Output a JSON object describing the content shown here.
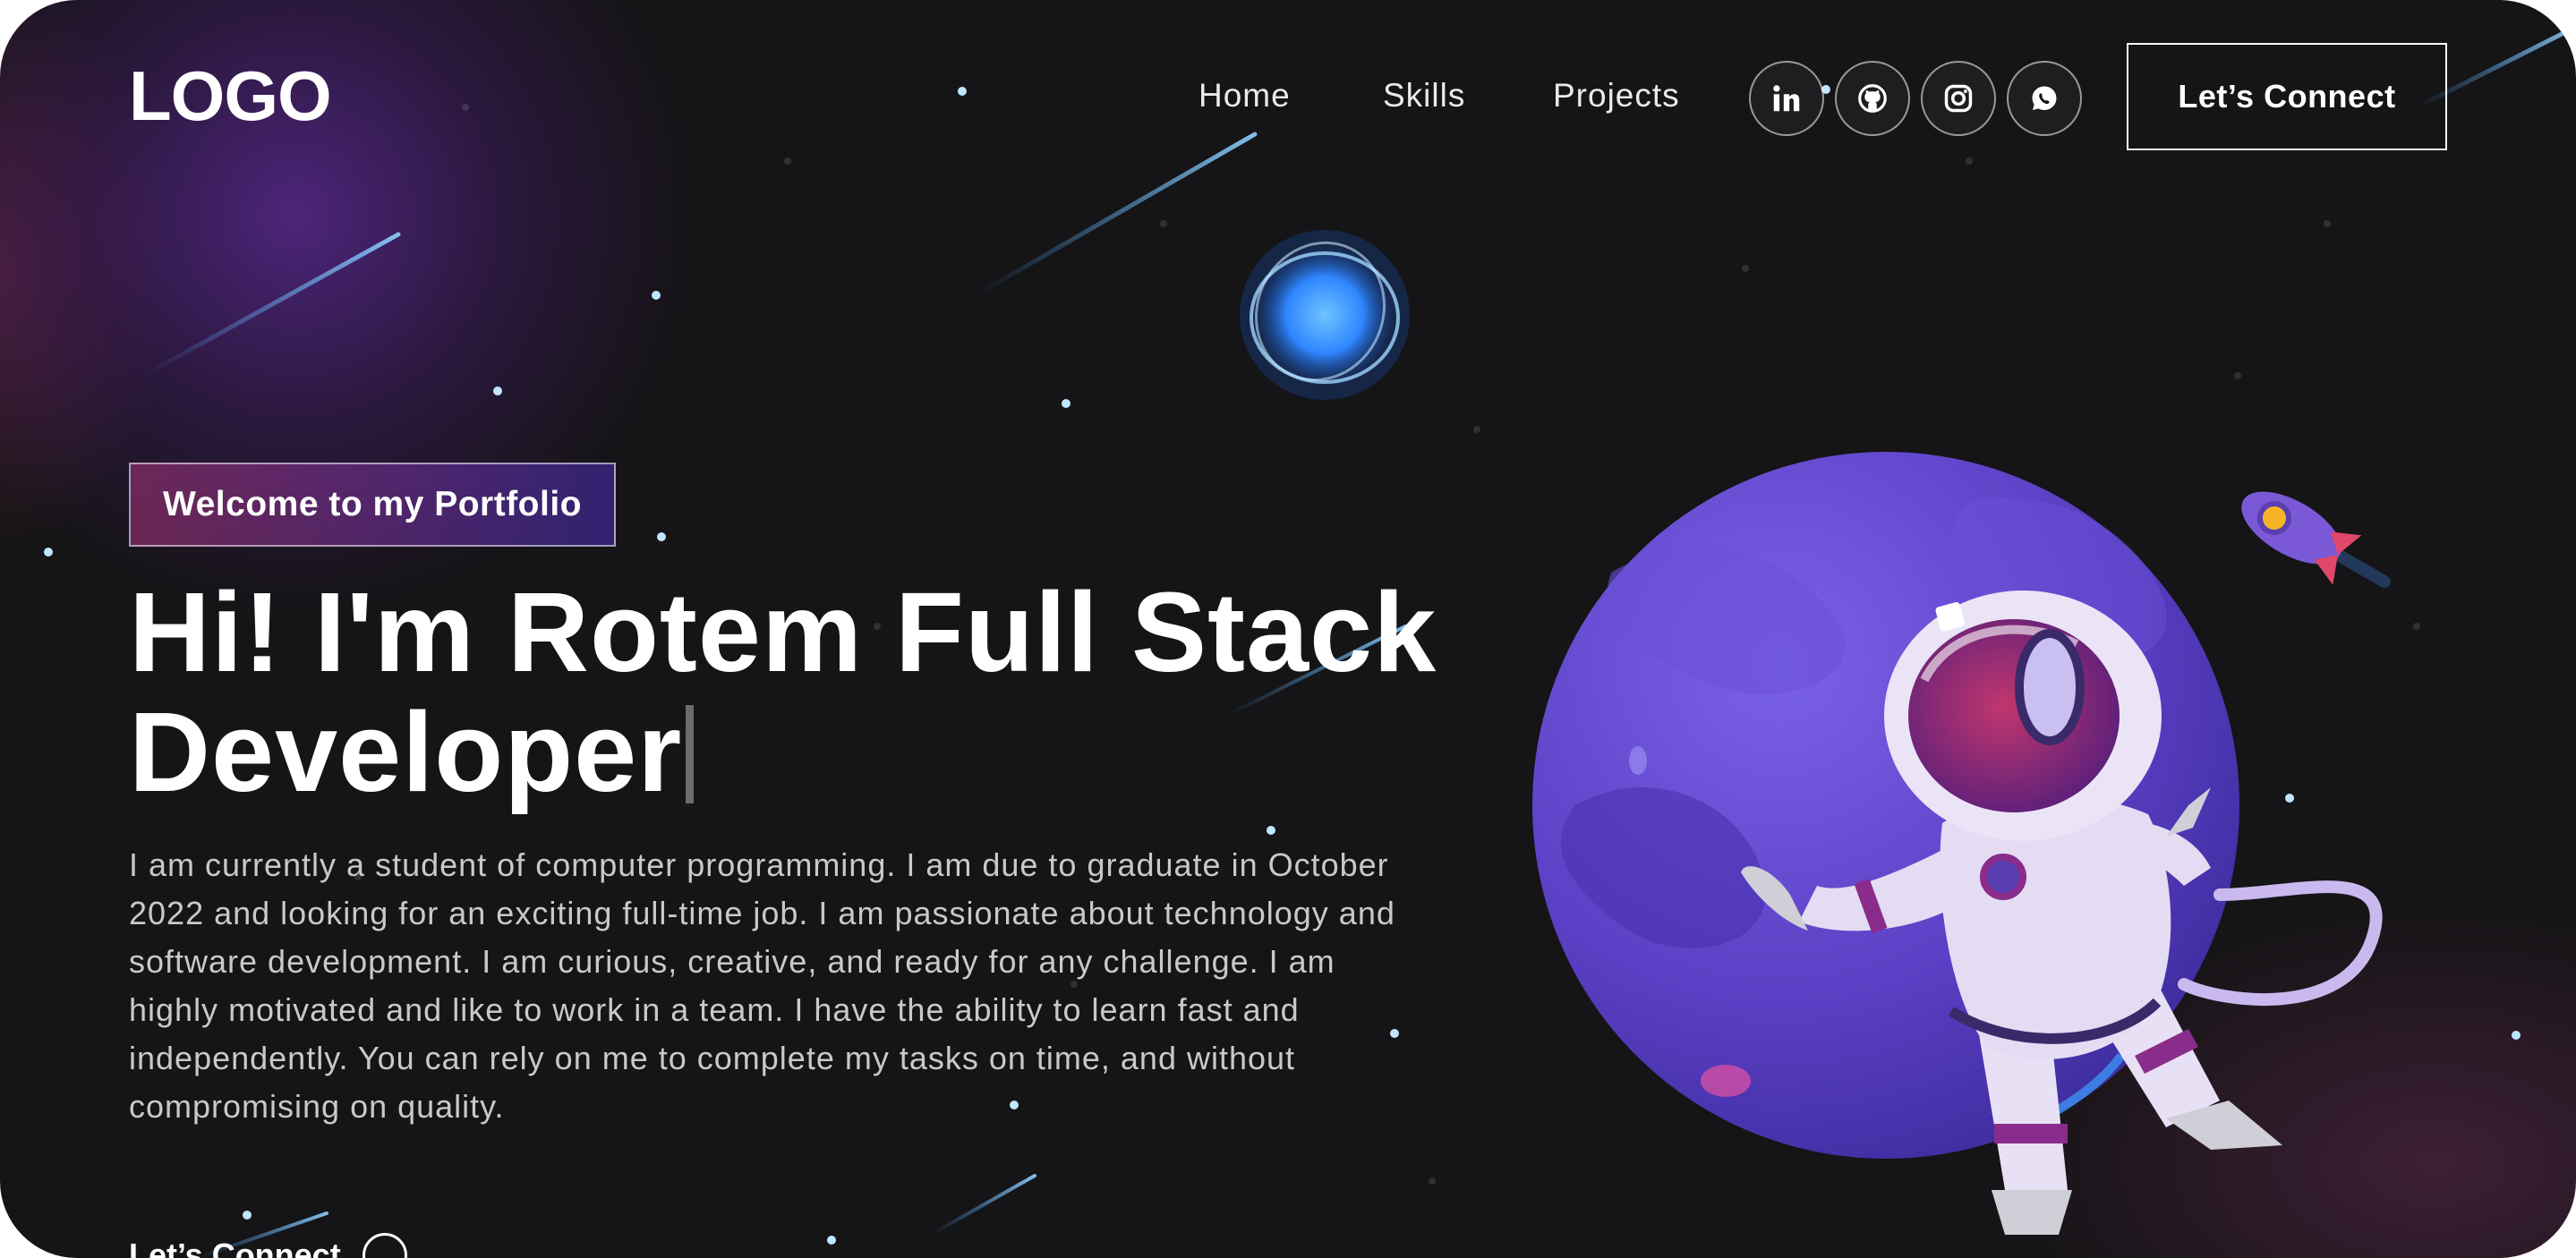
{
  "header": {
    "logo": "LOGO",
    "nav": [
      {
        "label": "Home"
      },
      {
        "label": "Skills"
      },
      {
        "label": "Projects"
      }
    ],
    "social": [
      {
        "icon": "linkedin-icon"
      },
      {
        "icon": "github-icon"
      },
      {
        "icon": "instagram-icon"
      },
      {
        "icon": "whatsapp-icon"
      }
    ],
    "connect_label": "Let’s Connect"
  },
  "banner": {
    "tagline": "Welcome to my Portfolio",
    "headline": "Hi! I'm Rotem Full Stack Developer",
    "intro": "I am currently a student of computer programming. I am due to graduate in October 2022 and looking for an exciting full-time job. I am passionate about technology and software development. I am curious, creative, and ready for any challenge. I am highly motivated and like to work in a team. I have the ability to learn fast and independently. You can rely on me to complete my tasks on time, and without compromising on quality.",
    "cta_label": "Let’s Connect"
  },
  "theme": {
    "background": "#151416",
    "accent_purple": "#4A2FBD",
    "accent_pink": "#AA367C",
    "planet": "#5B3FC4"
  }
}
